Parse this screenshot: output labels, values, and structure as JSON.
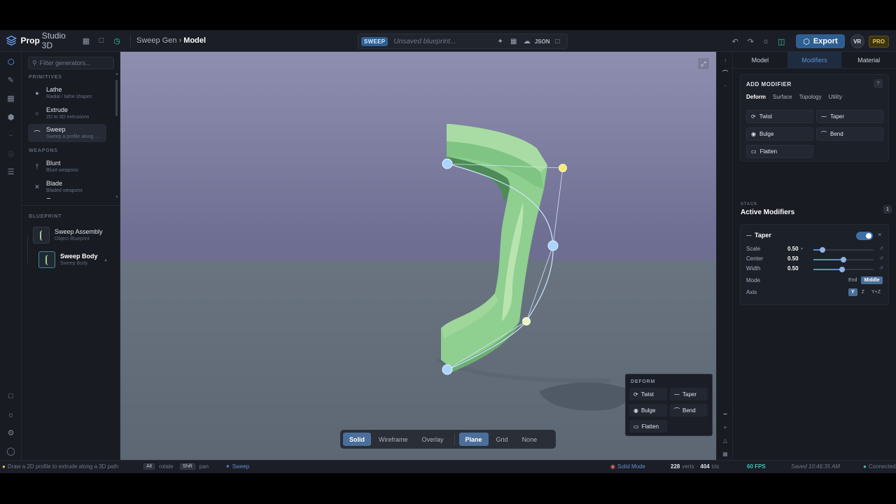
{
  "app": {
    "logo_bold": "Prop",
    "logo_rest": "Studio 3D",
    "breadcrumb_parent": "Sweep Gen",
    "breadcrumb_current": "Model"
  },
  "toolbar": {
    "blueprint_tag": "SWEEP",
    "blueprint_name": "Unsaved blueprint...",
    "json_label": "JSON",
    "export_label": "Export",
    "avatar": "VR",
    "plan_badge": "PRO"
  },
  "generators": {
    "filter_placeholder": "Filter generators...",
    "primitives_label": "PRIMITIVES",
    "weapons_label": "WEAPONS",
    "blueprint_label": "BLUEPRINT",
    "primitives": [
      {
        "title": "Lathe",
        "sub": "Radial / lathe shapes"
      },
      {
        "title": "Extrude",
        "sub": "2D to 3D extrusions"
      },
      {
        "title": "Sweep",
        "sub": "Sweep a profile along ..."
      }
    ],
    "weapons": [
      {
        "title": "Blunt",
        "sub": "Blunt weapons"
      },
      {
        "title": "Blade",
        "sub": "Bladed weapons"
      }
    ],
    "blueprint_items": [
      {
        "title": "Sweep Assembly",
        "sub": "Object Blueprint"
      },
      {
        "title": "Sweep Body",
        "sub": "Sweep Body"
      }
    ]
  },
  "viewport": {
    "view_modes": [
      "Solid",
      "Wireframe",
      "Overlay"
    ],
    "active_view": "Solid",
    "ground_modes": [
      "Plane",
      "Grid",
      "None"
    ],
    "active_ground": "Plane",
    "popup_label": "DEFORM",
    "popup_buttons": [
      "Twist",
      "Taper",
      "Bulge",
      "Bend",
      "Flatten"
    ]
  },
  "properties": {
    "tabs": [
      "Model",
      "Modifiers",
      "Material"
    ],
    "active_tab": "Modifiers",
    "add_modifier_title": "ADD MODIFIER",
    "help": "?",
    "categories": [
      "Deform",
      "Surface",
      "Topology",
      "Utility"
    ],
    "active_category": "Deform",
    "modifier_buttons": [
      "Twist",
      "Taper",
      "Bulge",
      "Bend",
      "Flatten"
    ],
    "stack_label": "STACK",
    "stack_title": "Active Modifiers",
    "stack_count": "1",
    "active_modifier": {
      "name": "Taper",
      "enabled": true,
      "params": [
        {
          "label": "Scale",
          "value": "0.50",
          "fraction": 0.15
        },
        {
          "label": "Center",
          "value": "0.50",
          "fraction": 0.5
        },
        {
          "label": "Width",
          "value": "0.50",
          "fraction": 0.48
        }
      ],
      "mode_label": "Mode",
      "mode_options": [
        "End",
        "Middle"
      ],
      "mode_selected": "Middle",
      "axis_label": "Axis",
      "axis_options": [
        "Y",
        "Z",
        "Y+Z"
      ],
      "axis_selected": "Y"
    }
  },
  "status": {
    "hint": "Draw a 2D profile to extrude along a 3D path",
    "key_alt": "Alt",
    "alt_action": "rotate",
    "key_shift": "Shift",
    "shift_action": "pan",
    "tool": "Sweep",
    "mode": "Solid Mode",
    "verts": "228",
    "verts_label": "verts",
    "tris": "404",
    "tris_label": "tris",
    "fps": "60 FPS",
    "saved": "Saved 10:46:35 AM",
    "connection": "Connected"
  },
  "colors": {
    "accent": "#2f5f92",
    "teal": "#38c3b3",
    "mesh_green": "#8fcf8f",
    "control_point": "#a9d5ff",
    "handle_yellow": "#f6ea79"
  }
}
